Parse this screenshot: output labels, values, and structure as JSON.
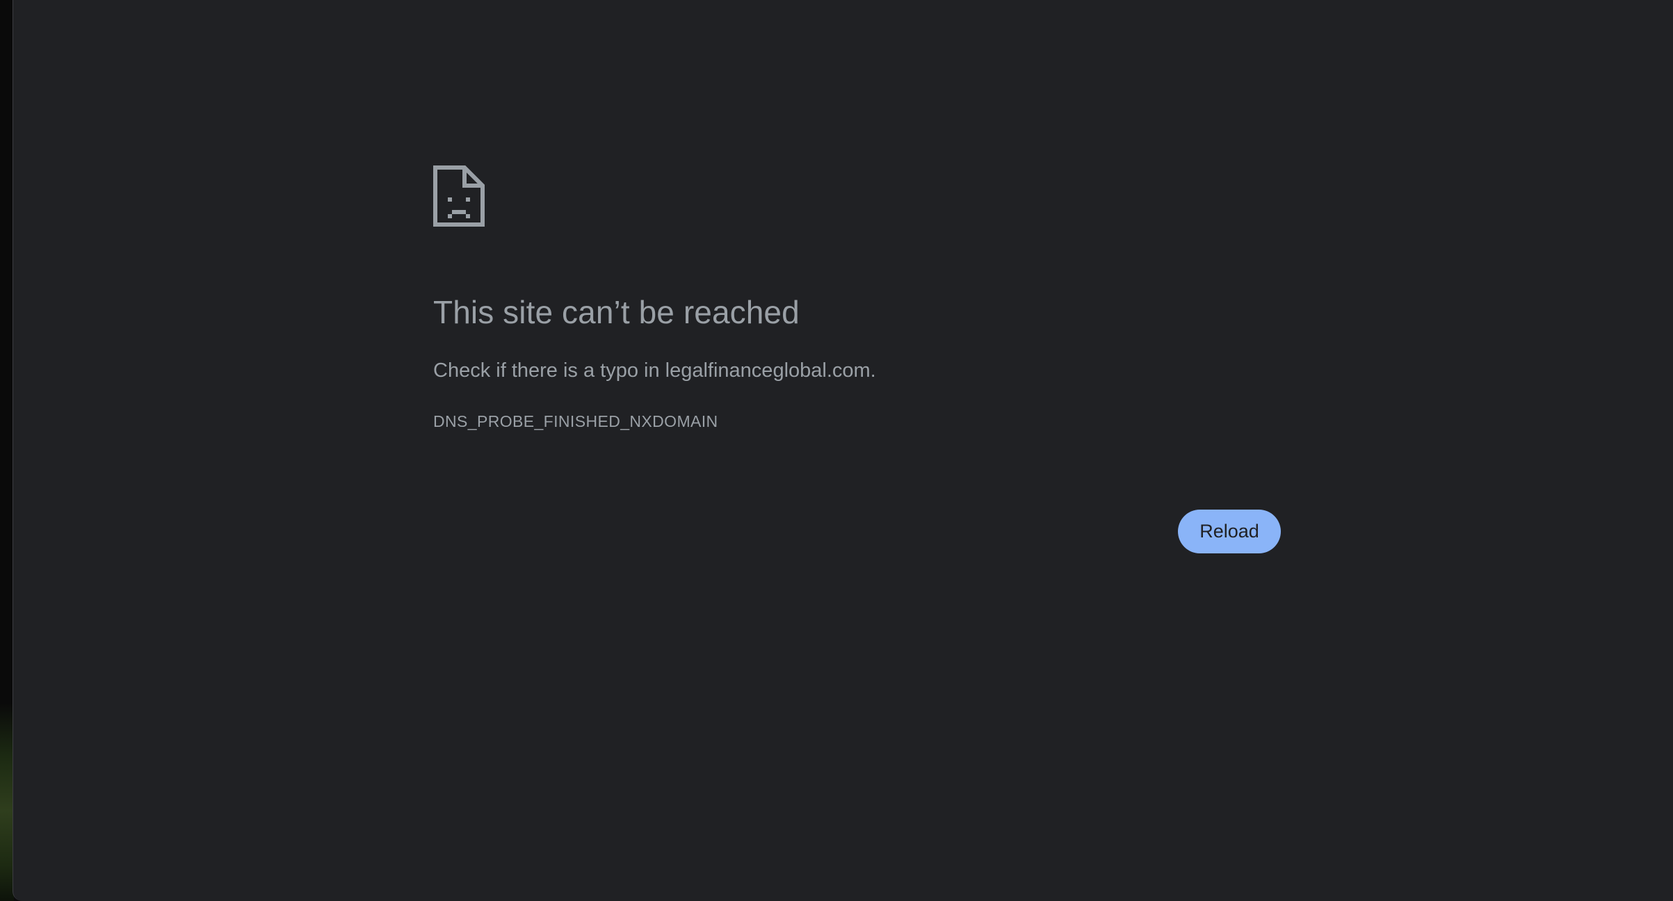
{
  "error_page": {
    "icon": "sad-page-icon",
    "title": "This site can’t be reached",
    "message": "Check if there is a typo in legalfinanceglobal.com.",
    "error_code": "DNS_PROBE_FINISHED_NXDOMAIN",
    "reload_label": "Reload"
  },
  "colors": {
    "background": "#202124",
    "text": "#9aa0a6",
    "button": "#8ab4f8",
    "button_text": "#202124"
  }
}
